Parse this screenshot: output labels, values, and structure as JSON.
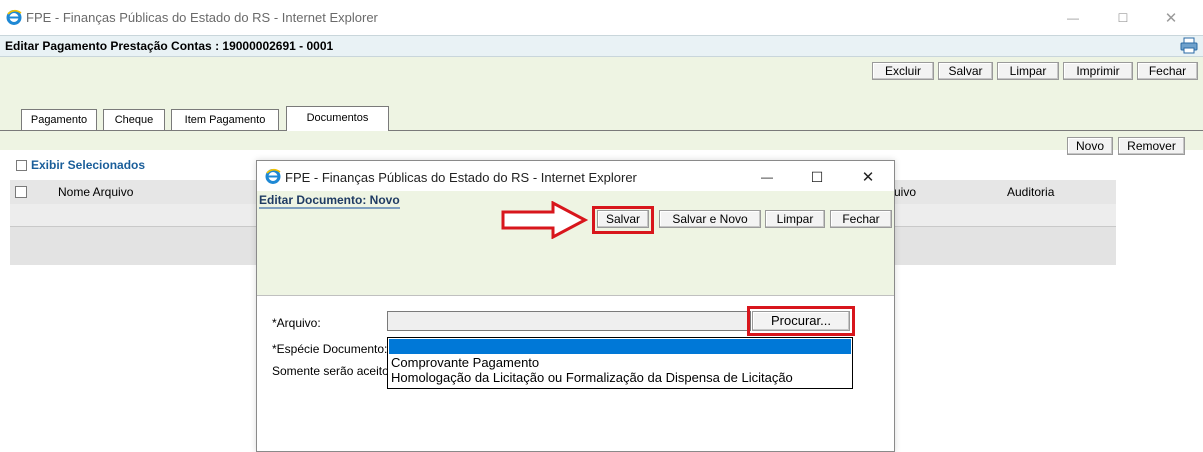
{
  "window": {
    "title": "FPE - Finanças Públicas do Estado do RS - Internet Explorer",
    "minimize_glyph": "—",
    "maximize_glyph": "☐",
    "close_glyph": "✕"
  },
  "page": {
    "title": "Editar Pagamento Prestação Contas : 19000002691 - 0001",
    "print_icon": "printer-icon",
    "toolbar": [
      "Excluir",
      "Salvar",
      "Limpar",
      "Imprimir",
      "Fechar"
    ],
    "tabs": [
      "Pagamento",
      "Cheque",
      "Item Pagamento",
      "Documentos"
    ],
    "active_tab": "Documentos",
    "actions": {
      "novo": "Novo",
      "remover": "Remover"
    },
    "exibir_selecionados": "Exibir Selecionados",
    "columns": {
      "nome_arquivo": "Nome Arquivo",
      "arquivo_partial": "uivo",
      "auditoria": "Auditoria"
    }
  },
  "dialog": {
    "title": "FPE - Finanças Públicas do Estado do RS - Internet Explorer",
    "minimize_glyph": "—",
    "maximize_glyph": "☐",
    "close_glyph": "✕",
    "heading": "Editar Documento: Novo",
    "buttons": {
      "salvar": "Salvar",
      "salvar_novo": "Salvar e Novo",
      "limpar": "Limpar",
      "fechar": "Fechar"
    },
    "arquivo_label": "*Arquivo:",
    "arquivo_value": "",
    "procurar": "Procurar...",
    "especie_label": "*Espécie Documento:",
    "note_partial": "Somente serão aceitos",
    "especie_options": [
      "",
      "Comprovante Pagamento",
      "Homologação da Licitação ou Formalização da Dispensa de Licitação"
    ]
  },
  "colors": {
    "highlight": "#d8161c",
    "selected_option": "#0078d7",
    "panel": "#eef4e3"
  }
}
